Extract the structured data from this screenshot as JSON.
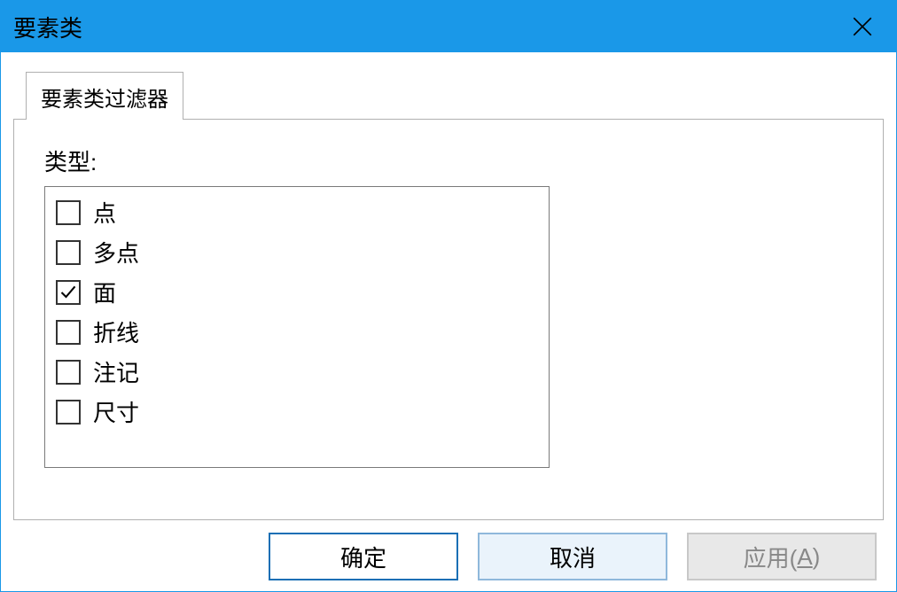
{
  "window": {
    "title": "要素类"
  },
  "tab": {
    "label": "要素类过滤器"
  },
  "content": {
    "type_label": "类型:",
    "items": [
      {
        "label": "点",
        "checked": false
      },
      {
        "label": "多点",
        "checked": false
      },
      {
        "label": "面",
        "checked": true
      },
      {
        "label": "折线",
        "checked": false
      },
      {
        "label": "注记",
        "checked": false
      },
      {
        "label": "尺寸",
        "checked": false
      }
    ]
  },
  "buttons": {
    "ok": "确定",
    "cancel": "取消",
    "apply_prefix": "应用(",
    "apply_key": "A",
    "apply_suffix": ")"
  }
}
